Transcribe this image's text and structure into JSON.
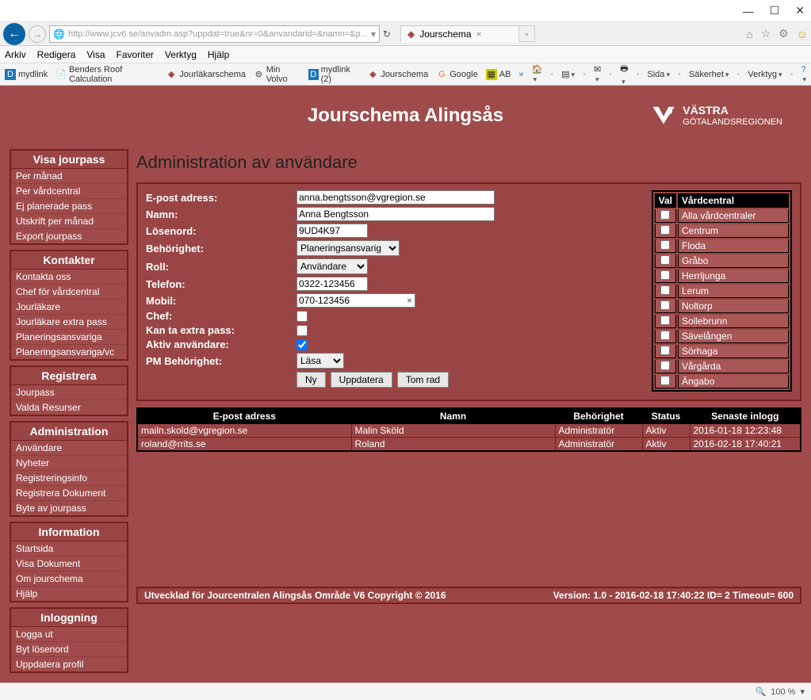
{
  "window": {
    "minimize": "—",
    "maximize": "☐",
    "close": "✕"
  },
  "addr": {
    "url": "http://www.jcv6.se/anvadm.asp?uppdat=true&nr=0&anvandarid=&namn=&p...",
    "tab_title": "Jourschema",
    "icons": {
      "home": "⌂",
      "star": "☆",
      "gear": "⚙",
      "smile": "☺"
    }
  },
  "menu": [
    "Arkiv",
    "Redigera",
    "Visa",
    "Favoriter",
    "Verktyg",
    "Hjälp"
  ],
  "favbar": {
    "left": [
      "mydlink",
      "Benders Roof Calculation",
      "Jourläkarschema",
      "Min Volvo",
      "mydlink (2)",
      "Jourschema",
      "Google",
      "AB"
    ],
    "right": [
      "Sida",
      "Säkerhet",
      "Verktyg"
    ]
  },
  "header": {
    "title": "Jourschema Alingsås",
    "brand1": "VÄSTRA",
    "brand2": "GÖTALANDSREGIONEN"
  },
  "sidebar": [
    {
      "title": "Visa jourpass",
      "items": [
        "Per månad",
        "Per vårdcentral",
        "Ej planerade pass",
        "Utskrift per månad",
        "Export jourpass"
      ]
    },
    {
      "title": "Kontakter",
      "items": [
        "Kontakta oss",
        "Chef för vårdcentral",
        "Jourläkare",
        "Jourläkare extra pass",
        "Planeringsansvariga",
        "Planeringsansvariga/vc"
      ]
    },
    {
      "title": "Registrera",
      "items": [
        "Jourpass",
        "Valda Resurser"
      ]
    },
    {
      "title": "Administration",
      "items": [
        "Användare",
        "Nyheter",
        "Registreringsinfo",
        "Registrera Dokument",
        "Byte av jourpass"
      ]
    },
    {
      "title": "Information",
      "items": [
        "Startsida",
        "Visa Dokument",
        "Om jourschema",
        "Hjälp"
      ]
    },
    {
      "title": "Inloggning",
      "items": [
        "Logga ut",
        "Byt lösenord",
        "Uppdatera profil"
      ]
    }
  ],
  "page_title": "Administration av användare",
  "form": {
    "labels": {
      "email": "E-post adress:",
      "namn": "Namn:",
      "losenord": "Lösenord:",
      "behorighet": "Behörighet:",
      "roll": "Roll:",
      "telefon": "Telefon:",
      "mobil": "Mobil:",
      "chef": "Chef:",
      "extra": "Kan ta extra pass:",
      "aktiv": "Aktiv användare:",
      "pm": "PM Behörighet:"
    },
    "values": {
      "email": "anna.bengtsson@vgregion.se",
      "namn": "Anna Bengtsson",
      "losenord": "9UD4K97",
      "behorighet": "Planeringsansvarig",
      "roll": "Användare",
      "telefon": "0322-123456",
      "mobil": "070-123456",
      "chef": false,
      "extra": false,
      "aktiv": true,
      "pm": "Läsa"
    },
    "buttons": {
      "ny": "Ny",
      "uppdatera": "Uppdatera",
      "tomrad": "Tom rad"
    }
  },
  "vc": {
    "headers": {
      "val": "Val",
      "vc": "Vårdcentral"
    },
    "rows": [
      "Alla vårdcentraler",
      "Centrum",
      "Floda",
      "Gråbo",
      "Herrljunga",
      "Lerum",
      "Noltorp",
      "Sollebrunn",
      "Sävelången",
      "Sörhaga",
      "Vårgårda",
      "Ängabo"
    ]
  },
  "users": {
    "headers": [
      "E-post adress",
      "Namn",
      "Behörighet",
      "Status",
      "Senaste inlogg"
    ],
    "rows": [
      {
        "email": "mailn.skold@vgregion.se",
        "namn": "Malin Sköld",
        "beh": "Administratör",
        "status": "Aktiv",
        "last": "2016-01-18 12:23:48"
      },
      {
        "email": "roland@rrits.se",
        "namn": "Roland",
        "beh": "Administratör",
        "status": "Aktiv",
        "last": "2016-02-18 17:40:21"
      }
    ]
  },
  "footer": {
    "left": "Utvecklad för Jourcentralen Alingsås Område V6 Copyright © 2016",
    "right": "Version: 1.0 - 2016-02-18 17:40:22 ID= 2 Timeout= 600"
  },
  "statusbar": {
    "zoom": "100 %"
  }
}
